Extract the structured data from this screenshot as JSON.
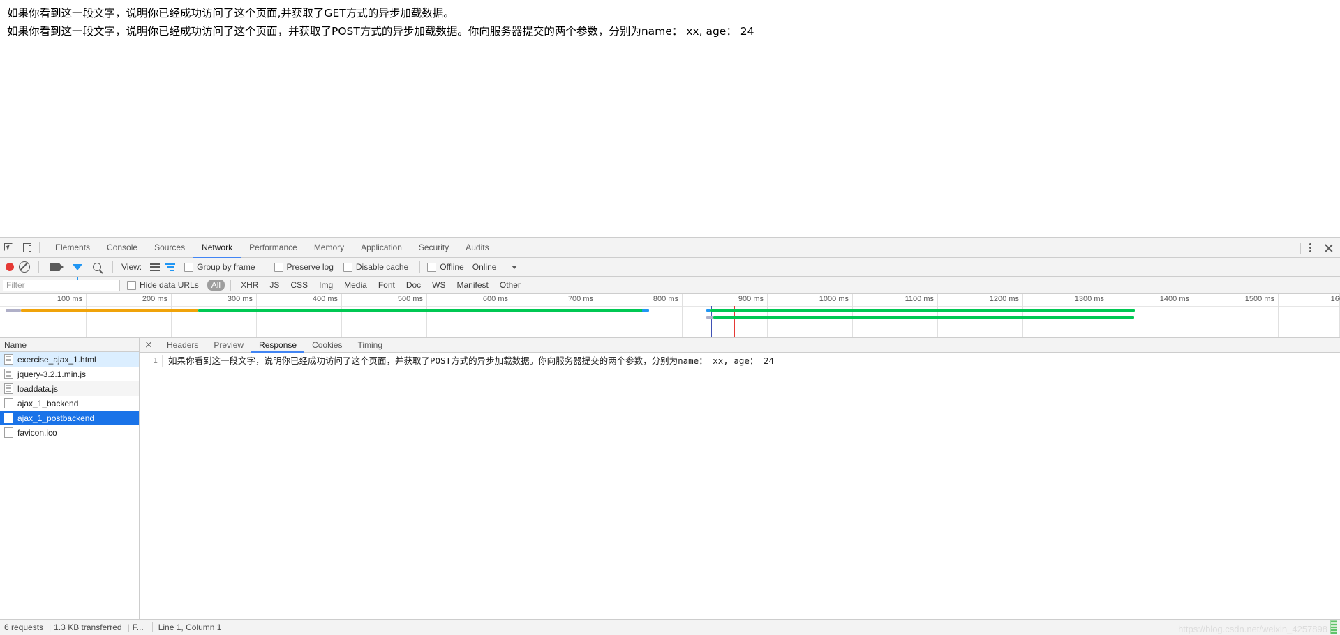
{
  "page": {
    "lines": [
      "如果你看到这一段文字，说明你已经成功访问了这个页面,并获取了GET方式的异步加载数据。",
      "如果你看到这一段文字，说明你已经成功访问了这个页面，并获取了POST方式的异步加载数据。你向服务器提交的两个参数，分别为name： xx, age： 24"
    ]
  },
  "devtools": {
    "main_tabs": [
      {
        "label": "Elements",
        "active": false
      },
      {
        "label": "Console",
        "active": false
      },
      {
        "label": "Sources",
        "active": false
      },
      {
        "label": "Network",
        "active": true
      },
      {
        "label": "Performance",
        "active": false
      },
      {
        "label": "Memory",
        "active": false
      },
      {
        "label": "Application",
        "active": false
      },
      {
        "label": "Security",
        "active": false
      },
      {
        "label": "Audits",
        "active": false
      }
    ],
    "icons": {
      "inspect": "inspect-element-icon",
      "device": "device-toolbar-icon",
      "kebab": "more-options-icon",
      "close": "close-devtools-icon"
    },
    "network_toolbar": {
      "record_label": "record-button",
      "clear_label": "clear-button",
      "capture_screenshots": "camera-icon",
      "filter_toggle": "funnel-icon",
      "search": "search-icon",
      "view_label": "View:",
      "group_by_frame": "Group by frame",
      "preserve_log": "Preserve log",
      "disable_cache": "Disable cache",
      "offline": "Offline",
      "throttle": "Online"
    },
    "filter_row": {
      "placeholder": "Filter",
      "hide_data_urls": "Hide data URLs",
      "types": [
        {
          "label": "All",
          "active": true
        },
        {
          "label": "XHR",
          "active": false
        },
        {
          "label": "JS",
          "active": false
        },
        {
          "label": "CSS",
          "active": false
        },
        {
          "label": "Img",
          "active": false
        },
        {
          "label": "Media",
          "active": false
        },
        {
          "label": "Font",
          "active": false
        },
        {
          "label": "Doc",
          "active": false
        },
        {
          "label": "WS",
          "active": false
        },
        {
          "label": "Manifest",
          "active": false
        },
        {
          "label": "Other",
          "active": false
        }
      ]
    },
    "timeline": {
      "ticks": [
        "100 ms",
        "200 ms",
        "300 ms",
        "400 ms",
        "500 ms",
        "600 ms",
        "700 ms",
        "800 ms",
        "900 ms",
        "1000 ms",
        "1100 ms",
        "1200 ms",
        "1300 ms",
        "1400 ms",
        "1500 ms",
        "160"
      ],
      "colors": {
        "orange": "#f0a30a",
        "green": "#00c853",
        "blue": "#3f51b5",
        "red": "#e53935"
      }
    },
    "requests": {
      "column_header": "Name",
      "rows": [
        {
          "name": "exercise_ajax_1.html",
          "icon": "document-icon",
          "state": "hl"
        },
        {
          "name": "jquery-3.2.1.min.js",
          "icon": "document-icon",
          "state": "normal"
        },
        {
          "name": "loaddata.js",
          "icon": "document-icon",
          "state": "stripe"
        },
        {
          "name": "ajax_1_backend",
          "icon": "generic-file-icon",
          "state": "normal"
        },
        {
          "name": "ajax_1_postbackend",
          "icon": "generic-file-icon",
          "state": "sel"
        },
        {
          "name": "favicon.ico",
          "icon": "generic-file-icon",
          "state": "normal"
        }
      ]
    },
    "detail": {
      "tabs": [
        {
          "label": "Headers",
          "active": false
        },
        {
          "label": "Preview",
          "active": false
        },
        {
          "label": "Response",
          "active": true
        },
        {
          "label": "Cookies",
          "active": false
        },
        {
          "label": "Timing",
          "active": false
        }
      ],
      "response": {
        "line_number": "1",
        "text": "如果你看到这一段文字，说明你已经成功访问了这个页面，并获取了POST方式的异步加载数据。你向服务器提交的两个参数，分别为name： xx, age： 24"
      }
    },
    "statusbar": {
      "requests": "6 requests",
      "transferred": "1.3 KB transferred",
      "finish": "F...",
      "cursor": "Line 1, Column 1"
    }
  },
  "watermark": "https://blog.csdn.net/weixin_4257898"
}
